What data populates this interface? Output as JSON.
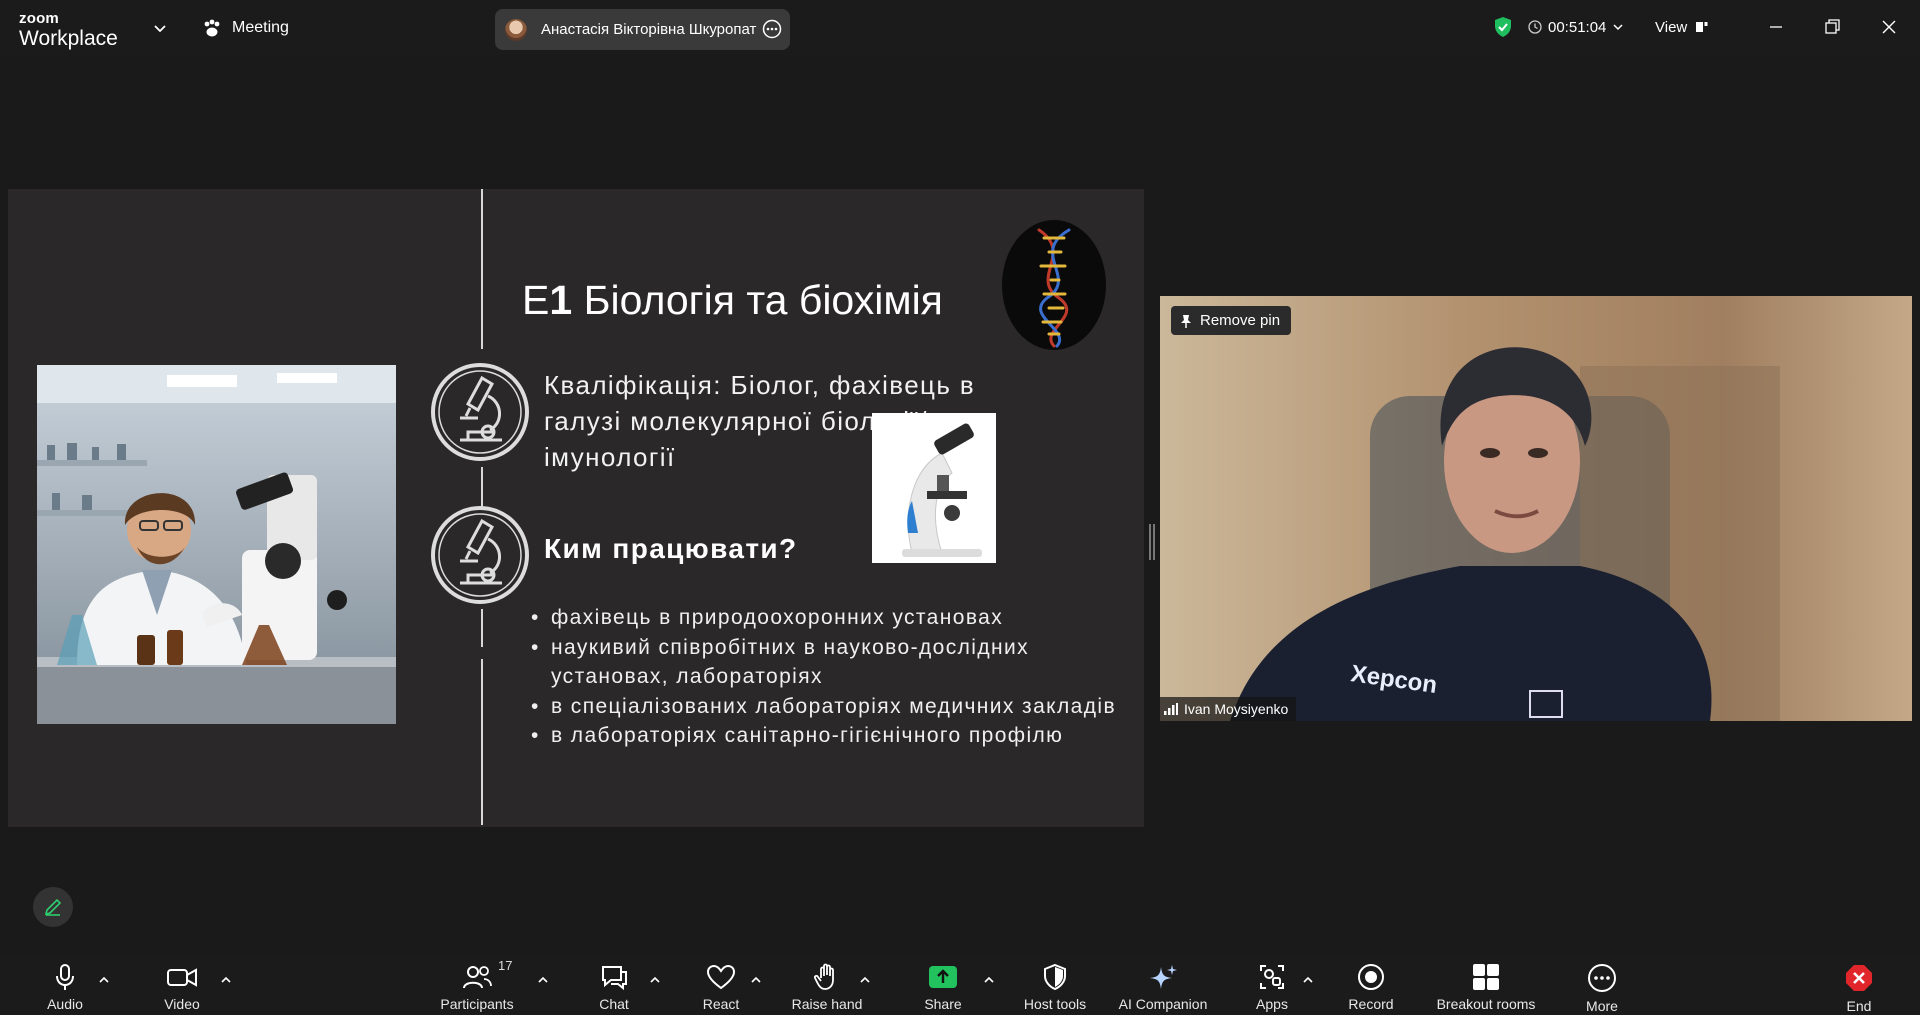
{
  "app": {
    "logo_line1": "zoom",
    "logo_line2": "Workplace",
    "meeting_label": "Meeting"
  },
  "active_speaker": {
    "name": "Анастасія Вікторівна Шкуропат"
  },
  "header_right": {
    "timer": "00:51:04",
    "view_label": "View",
    "security_color": "#1fbf5f"
  },
  "slide": {
    "title_prefix": "Е",
    "title_number": "1",
    "title_rest": " Біологія та біохімія",
    "qualification": "Кваліфікація: Біолог, фахівець в галузі молекулярної біології/імунології",
    "career_heading": "Ким працювати?",
    "careers": [
      "фахівець в природоохоронних установах",
      "наукивий співробітних в науково-дослідних установах, лабораторіях",
      "в спеціалізованих лабораторіях медичних закладів",
      "в лабораторіях санітарно-гігієнічного профілю"
    ]
  },
  "video_tile": {
    "remove_pin_label": "Remove pin",
    "participant_name": "Ivan Moysiyenko"
  },
  "toolbar": {
    "participants_count": "17",
    "items": [
      "Audio",
      "Video",
      "Participants",
      "Chat",
      "React",
      "Raise hand",
      "Share",
      "Host tools",
      "AI Companion",
      "Apps",
      "Record",
      "Breakout rooms",
      "More",
      "End"
    ],
    "share_color": "#22c35e",
    "end_color": "#e0252b"
  }
}
